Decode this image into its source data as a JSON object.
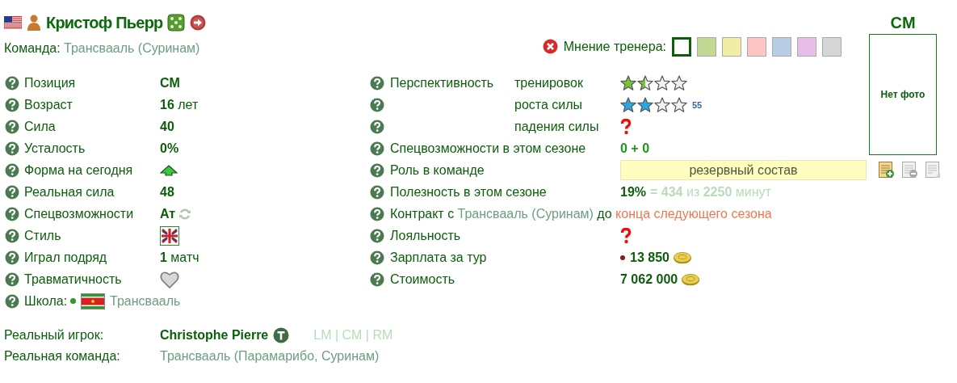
{
  "header": {
    "name": "Кристоф Пьерр"
  },
  "team": {
    "label": "Команда:",
    "value": "Трансвааль (Суринам)"
  },
  "coach_opinion": {
    "label": "Мнение тренера:",
    "options": [
      {
        "color": "#ffffff",
        "selected": true
      },
      {
        "color": "#c2d994",
        "selected": false
      },
      {
        "color": "#f2eda5",
        "selected": false
      },
      {
        "color": "#ffc4c4",
        "selected": false
      },
      {
        "color": "#b8cde6",
        "selected": false
      },
      {
        "color": "#e8bdea",
        "selected": false
      },
      {
        "color": "#d6d6d6",
        "selected": false
      }
    ]
  },
  "photo": {
    "position": "CM",
    "text": "Нет фото"
  },
  "stats": [
    {
      "kind": "text",
      "label": "Позиция",
      "value": "CM"
    },
    {
      "kind": "text",
      "label": "Возраст",
      "value": "16",
      "unit": "лет"
    },
    {
      "kind": "text",
      "label": "Сила",
      "value": "40"
    },
    {
      "kind": "text",
      "label": "Усталость",
      "value": "0%"
    },
    {
      "kind": "form_up",
      "label": "Форма на сегодня"
    },
    {
      "kind": "text",
      "label": "Реальная сила",
      "value": "48"
    },
    {
      "kind": "special",
      "label": "Спецвозможности",
      "value": "Ат"
    },
    {
      "kind": "style",
      "label": "Стиль"
    },
    {
      "kind": "text",
      "label": "Играл подряд",
      "value": "1",
      "unit": "матч"
    },
    {
      "kind": "injury",
      "label": "Травматичность"
    },
    {
      "kind": "school",
      "label": "Школа:",
      "value": "Трансвааль",
      "color": "#2e9a2e"
    }
  ],
  "prospects": [
    {
      "kind": "stars",
      "label": "Перспективность",
      "sublabel": "тренировок",
      "stars": 1.5,
      "color": "#7ec23a"
    },
    {
      "kind": "stars",
      "sublabel": "роста силы",
      "stars": 2,
      "color": "#2aa8e0",
      "note": "55"
    },
    {
      "kind": "unknown",
      "sublabel": "падения силы"
    },
    {
      "kind": "count",
      "label": "Спецвозможности в этом сезоне",
      "value": "0 + 0"
    },
    {
      "kind": "role",
      "label": "Роль в команде",
      "value": "резервный состав",
      "actions": [
        {
          "kind": "add",
          "disabled": false
        },
        {
          "kind": "remove",
          "disabled": true
        },
        {
          "kind": "note",
          "disabled": true
        }
      ]
    },
    {
      "kind": "usefulness",
      "label": "Полезность в этом сезоне",
      "value": "19%",
      "detail": "**= 434** из **2250** минут"
    },
    {
      "kind": "contract",
      "label": "Контракт с",
      "team": "Трансвааль (Суринам)",
      "until_label": "до",
      "until": "конца следующего сезона"
    },
    {
      "kind": "unknown",
      "label": "Лояльность"
    },
    {
      "kind": "money",
      "label": "Зарплата за тур",
      "value": "13 850",
      "color": "#8b1a1a"
    },
    {
      "kind": "money",
      "label": "Стоимость",
      "value": "7 062 000"
    }
  ],
  "real": {
    "player_label": "Реальный игрок:",
    "player": "Christophe Pierre",
    "positions": "LM | CM | RM",
    "team_label": "Реальная команда:",
    "team": "Трансвааль (Парамарибо, Суринам)"
  }
}
